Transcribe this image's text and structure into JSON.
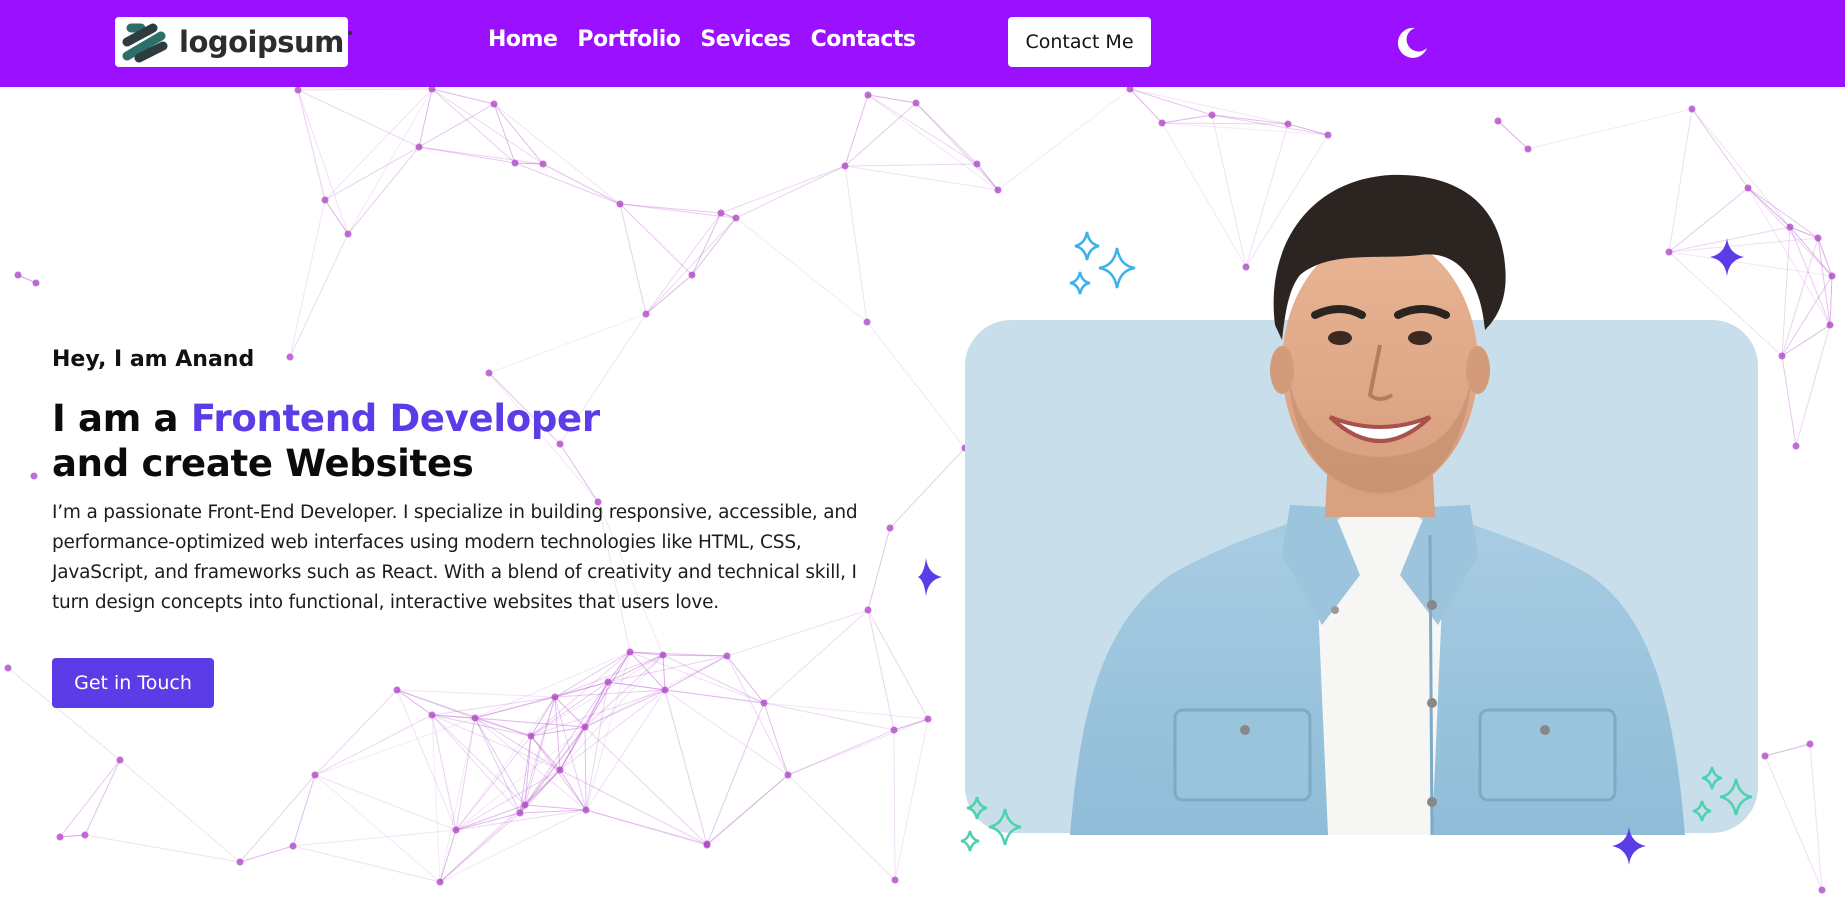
{
  "header": {
    "logo_text": "logoipsum",
    "nav": [
      {
        "label": "Home"
      },
      {
        "label": "Portfolio"
      },
      {
        "label": "Sevices"
      },
      {
        "label": "Contacts"
      }
    ],
    "contact_button": "Contact Me",
    "theme_toggle_icon": "moon-icon"
  },
  "hero": {
    "greeting": "Hey, I am Anand",
    "headline_prefix": "I am a ",
    "headline_accent": "Frontend Developer",
    "headline_suffix": "and create Websites",
    "description": "I’m a passionate Front-End Developer. I specialize in building responsive, accessible, and performance-optimized web interfaces using modern technologies like HTML, CSS, JavaScript, and frameworks such as React. With a blend of creativity and technical skill, I turn design concepts into functional, interactive websites that users love.",
    "cta_button": "Get in Touch"
  },
  "colors": {
    "navbar": "#9a10ff",
    "accent": "#5b3ce6",
    "network": "#b04ac8",
    "sparkle_blue": "#3fb1ea",
    "sparkle_teal": "#4fd0b0",
    "photo_bg": "#c8dfeb"
  }
}
